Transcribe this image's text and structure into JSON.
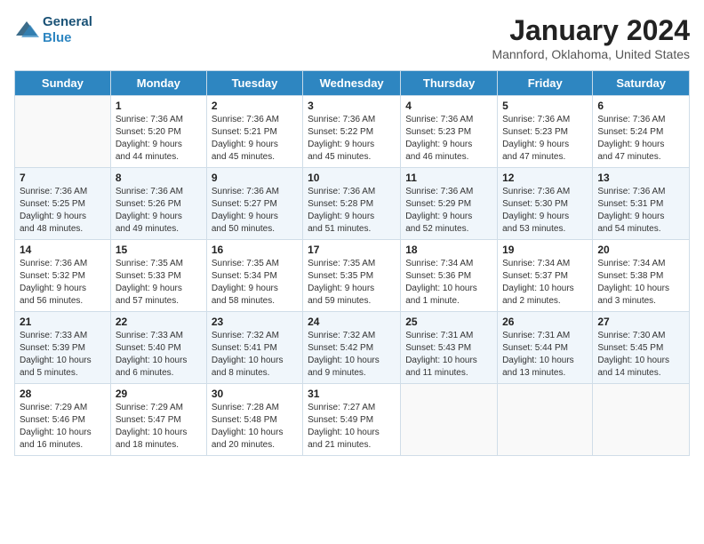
{
  "header": {
    "logo_line1": "General",
    "logo_line2": "Blue",
    "month": "January 2024",
    "location": "Mannford, Oklahoma, United States"
  },
  "weekdays": [
    "Sunday",
    "Monday",
    "Tuesday",
    "Wednesday",
    "Thursday",
    "Friday",
    "Saturday"
  ],
  "weeks": [
    [
      {
        "day": "",
        "text": ""
      },
      {
        "day": "1",
        "text": "Sunrise: 7:36 AM\nSunset: 5:20 PM\nDaylight: 9 hours\nand 44 minutes."
      },
      {
        "day": "2",
        "text": "Sunrise: 7:36 AM\nSunset: 5:21 PM\nDaylight: 9 hours\nand 45 minutes."
      },
      {
        "day": "3",
        "text": "Sunrise: 7:36 AM\nSunset: 5:22 PM\nDaylight: 9 hours\nand 45 minutes."
      },
      {
        "day": "4",
        "text": "Sunrise: 7:36 AM\nSunset: 5:23 PM\nDaylight: 9 hours\nand 46 minutes."
      },
      {
        "day": "5",
        "text": "Sunrise: 7:36 AM\nSunset: 5:23 PM\nDaylight: 9 hours\nand 47 minutes."
      },
      {
        "day": "6",
        "text": "Sunrise: 7:36 AM\nSunset: 5:24 PM\nDaylight: 9 hours\nand 47 minutes."
      }
    ],
    [
      {
        "day": "7",
        "text": "Sunrise: 7:36 AM\nSunset: 5:25 PM\nDaylight: 9 hours\nand 48 minutes."
      },
      {
        "day": "8",
        "text": "Sunrise: 7:36 AM\nSunset: 5:26 PM\nDaylight: 9 hours\nand 49 minutes."
      },
      {
        "day": "9",
        "text": "Sunrise: 7:36 AM\nSunset: 5:27 PM\nDaylight: 9 hours\nand 50 minutes."
      },
      {
        "day": "10",
        "text": "Sunrise: 7:36 AM\nSunset: 5:28 PM\nDaylight: 9 hours\nand 51 minutes."
      },
      {
        "day": "11",
        "text": "Sunrise: 7:36 AM\nSunset: 5:29 PM\nDaylight: 9 hours\nand 52 minutes."
      },
      {
        "day": "12",
        "text": "Sunrise: 7:36 AM\nSunset: 5:30 PM\nDaylight: 9 hours\nand 53 minutes."
      },
      {
        "day": "13",
        "text": "Sunrise: 7:36 AM\nSunset: 5:31 PM\nDaylight: 9 hours\nand 54 minutes."
      }
    ],
    [
      {
        "day": "14",
        "text": "Sunrise: 7:36 AM\nSunset: 5:32 PM\nDaylight: 9 hours\nand 56 minutes."
      },
      {
        "day": "15",
        "text": "Sunrise: 7:35 AM\nSunset: 5:33 PM\nDaylight: 9 hours\nand 57 minutes."
      },
      {
        "day": "16",
        "text": "Sunrise: 7:35 AM\nSunset: 5:34 PM\nDaylight: 9 hours\nand 58 minutes."
      },
      {
        "day": "17",
        "text": "Sunrise: 7:35 AM\nSunset: 5:35 PM\nDaylight: 9 hours\nand 59 minutes."
      },
      {
        "day": "18",
        "text": "Sunrise: 7:34 AM\nSunset: 5:36 PM\nDaylight: 10 hours\nand 1 minute."
      },
      {
        "day": "19",
        "text": "Sunrise: 7:34 AM\nSunset: 5:37 PM\nDaylight: 10 hours\nand 2 minutes."
      },
      {
        "day": "20",
        "text": "Sunrise: 7:34 AM\nSunset: 5:38 PM\nDaylight: 10 hours\nand 3 minutes."
      }
    ],
    [
      {
        "day": "21",
        "text": "Sunrise: 7:33 AM\nSunset: 5:39 PM\nDaylight: 10 hours\nand 5 minutes."
      },
      {
        "day": "22",
        "text": "Sunrise: 7:33 AM\nSunset: 5:40 PM\nDaylight: 10 hours\nand 6 minutes."
      },
      {
        "day": "23",
        "text": "Sunrise: 7:32 AM\nSunset: 5:41 PM\nDaylight: 10 hours\nand 8 minutes."
      },
      {
        "day": "24",
        "text": "Sunrise: 7:32 AM\nSunset: 5:42 PM\nDaylight: 10 hours\nand 9 minutes."
      },
      {
        "day": "25",
        "text": "Sunrise: 7:31 AM\nSunset: 5:43 PM\nDaylight: 10 hours\nand 11 minutes."
      },
      {
        "day": "26",
        "text": "Sunrise: 7:31 AM\nSunset: 5:44 PM\nDaylight: 10 hours\nand 13 minutes."
      },
      {
        "day": "27",
        "text": "Sunrise: 7:30 AM\nSunset: 5:45 PM\nDaylight: 10 hours\nand 14 minutes."
      }
    ],
    [
      {
        "day": "28",
        "text": "Sunrise: 7:29 AM\nSunset: 5:46 PM\nDaylight: 10 hours\nand 16 minutes."
      },
      {
        "day": "29",
        "text": "Sunrise: 7:29 AM\nSunset: 5:47 PM\nDaylight: 10 hours\nand 18 minutes."
      },
      {
        "day": "30",
        "text": "Sunrise: 7:28 AM\nSunset: 5:48 PM\nDaylight: 10 hours\nand 20 minutes."
      },
      {
        "day": "31",
        "text": "Sunrise: 7:27 AM\nSunset: 5:49 PM\nDaylight: 10 hours\nand 21 minutes."
      },
      {
        "day": "",
        "text": ""
      },
      {
        "day": "",
        "text": ""
      },
      {
        "day": "",
        "text": ""
      }
    ]
  ]
}
